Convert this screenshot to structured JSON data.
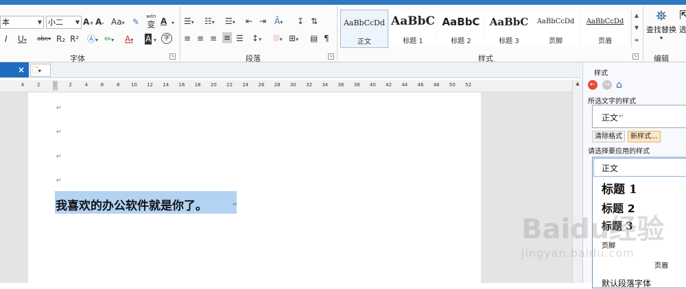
{
  "ribbon": {
    "font_group": {
      "label": "字体",
      "font_name": "本",
      "font_size": "小二",
      "btn_aa": "Aa",
      "btn_phonetic_top": "wén",
      "btn_phonetic": "变",
      "btn_underline_a": "A",
      "btn_bold_letter": "I",
      "btn_underline": "U",
      "btn_strike": "abc",
      "btn_sub": "R₂",
      "btn_sup": "R²",
      "btn_font_color": "A",
      "btn_char_border": "字"
    },
    "para_group": {
      "label": "段落",
      "btn_pilcrow": "¶"
    },
    "styles_group": {
      "label": "样式",
      "cards": [
        {
          "preview": "AaBbCcDd",
          "name": "正文"
        },
        {
          "preview": "AaBbC",
          "name": "标题 1"
        },
        {
          "preview": "AaBbC",
          "name": "标题 2"
        },
        {
          "preview": "AaBbC",
          "name": "标题 3"
        },
        {
          "preview": "AaBbCcDd",
          "name": "页脚"
        },
        {
          "preview": "AaBbCcDd",
          "name": "页眉"
        }
      ]
    },
    "edit_group": {
      "label": "编辑",
      "find_replace": "查找替换",
      "select_partial": "选"
    }
  },
  "ruler": {
    "ticks": [
      "4",
      "2",
      "2",
      "2",
      "4",
      "6",
      "8",
      "10",
      "12",
      "14",
      "16",
      "18",
      "20",
      "22",
      "24",
      "26",
      "28",
      "30",
      "32",
      "34",
      "36",
      "38",
      "40",
      "42",
      "44",
      "46",
      "48",
      "50",
      "52"
    ]
  },
  "document": {
    "para_mark": "↵",
    "selected_text": "我喜欢的办公软件就是你了。"
  },
  "style_pane": {
    "title": "样式",
    "selected_text_style_label": "所选文字的样式",
    "current_style": "正文",
    "btn_clear": "清除格式",
    "btn_new": "新样式...",
    "apply_label": "请选择要应用的样式",
    "list": [
      {
        "name": "正文"
      },
      {
        "name": "标题 1"
      },
      {
        "name": "标题 2"
      },
      {
        "name": "标题 3"
      },
      {
        "name": "页脚"
      },
      {
        "name": "页眉"
      },
      {
        "name": "默认段落字体"
      }
    ]
  },
  "watermark": {
    "brand": "Baidu经验",
    "url": "jingyan.baidu.com"
  },
  "colors": {
    "accent": "#2b79c2",
    "selection": "#b3d3f2",
    "tab": "#1f6cc2"
  }
}
